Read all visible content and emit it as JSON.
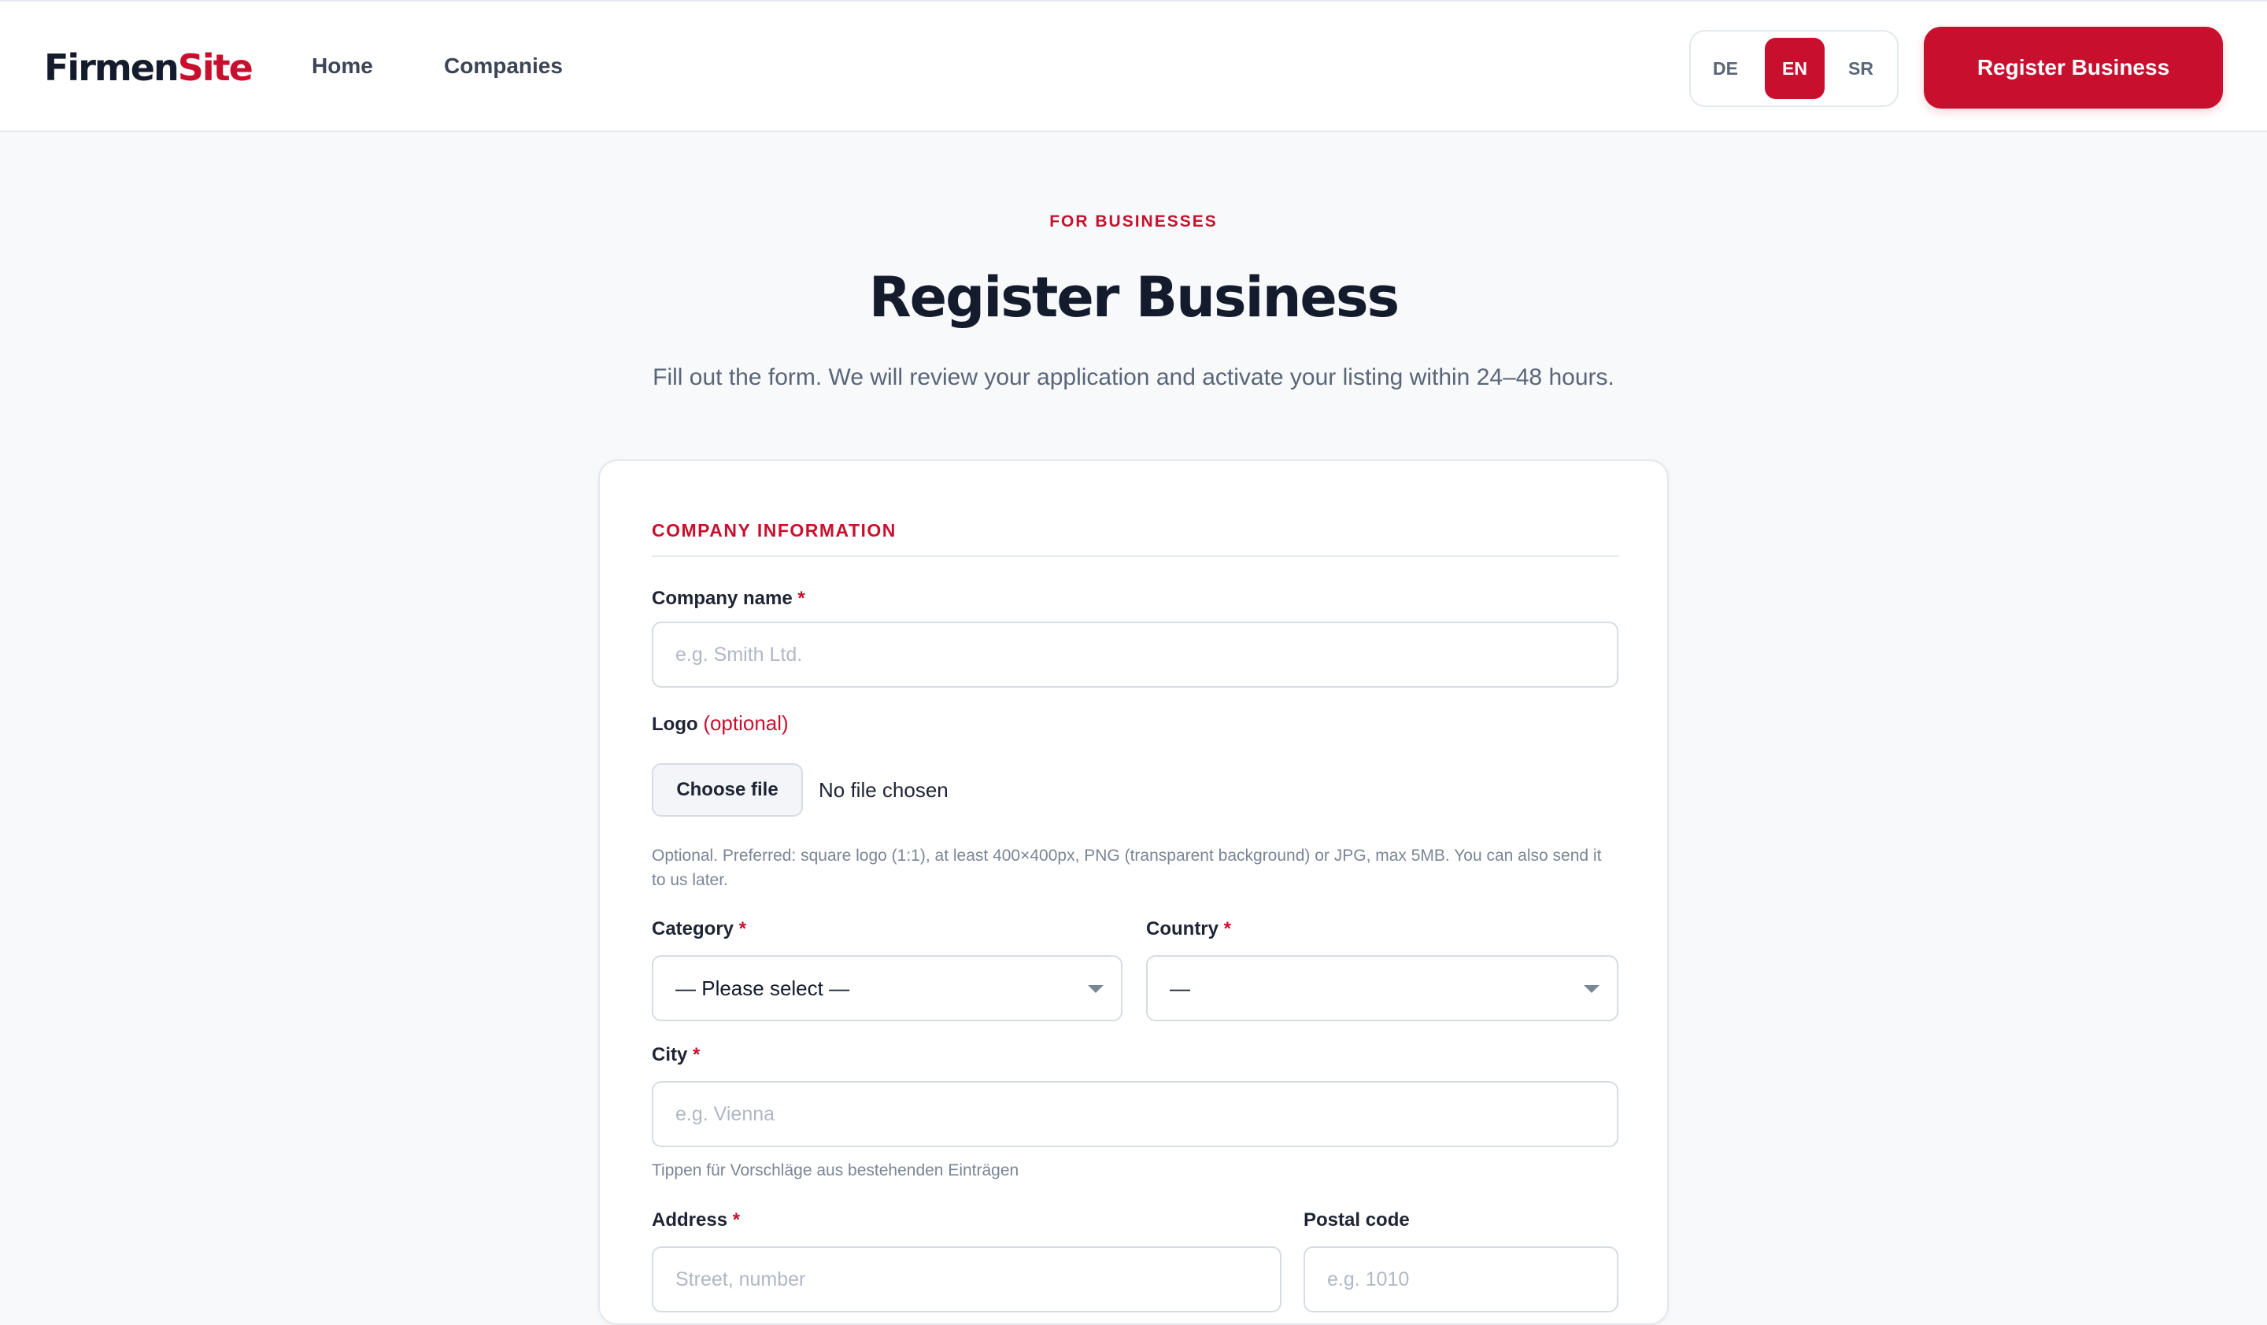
{
  "header": {
    "logo_part1": "Firmen",
    "logo_part2": "Site",
    "nav": {
      "home": "Home",
      "companies": "Companies"
    },
    "languages": [
      "DE",
      "EN",
      "SR"
    ],
    "active_language": "EN",
    "cta": "Register Business"
  },
  "hero": {
    "kicker": "FOR BUSINESSES",
    "title": "Register Business",
    "subtitle": "Fill out the form. We will review your application and activate your listing within 24–48 hours."
  },
  "form": {
    "section_title": "COMPANY INFORMATION",
    "required_mark": "*",
    "company_name": {
      "label": "Company name",
      "placeholder": "e.g. Smith Ltd."
    },
    "logo": {
      "label": "Logo",
      "optional": "(optional)",
      "button": "Choose file",
      "status": "No file chosen",
      "hint": "Optional. Preferred: square logo (1:1), at least 400×400px, PNG (transparent background) or JPG, max 5MB. You can also send it to us later."
    },
    "category": {
      "label": "Category",
      "value": "— Please select —"
    },
    "country": {
      "label": "Country",
      "value": "—"
    },
    "city": {
      "label": "City",
      "placeholder": "e.g. Vienna",
      "hint": "Tippen für Vorschläge aus bestehenden Einträgen"
    },
    "address": {
      "label": "Address",
      "placeholder": "Street, number"
    },
    "postal_code": {
      "label": "Postal code",
      "placeholder": "e.g. 1010"
    }
  },
  "colors": {
    "accent": "#c8102e",
    "text_dark": "#141b2d",
    "page_bg": "#f7f9fb"
  }
}
